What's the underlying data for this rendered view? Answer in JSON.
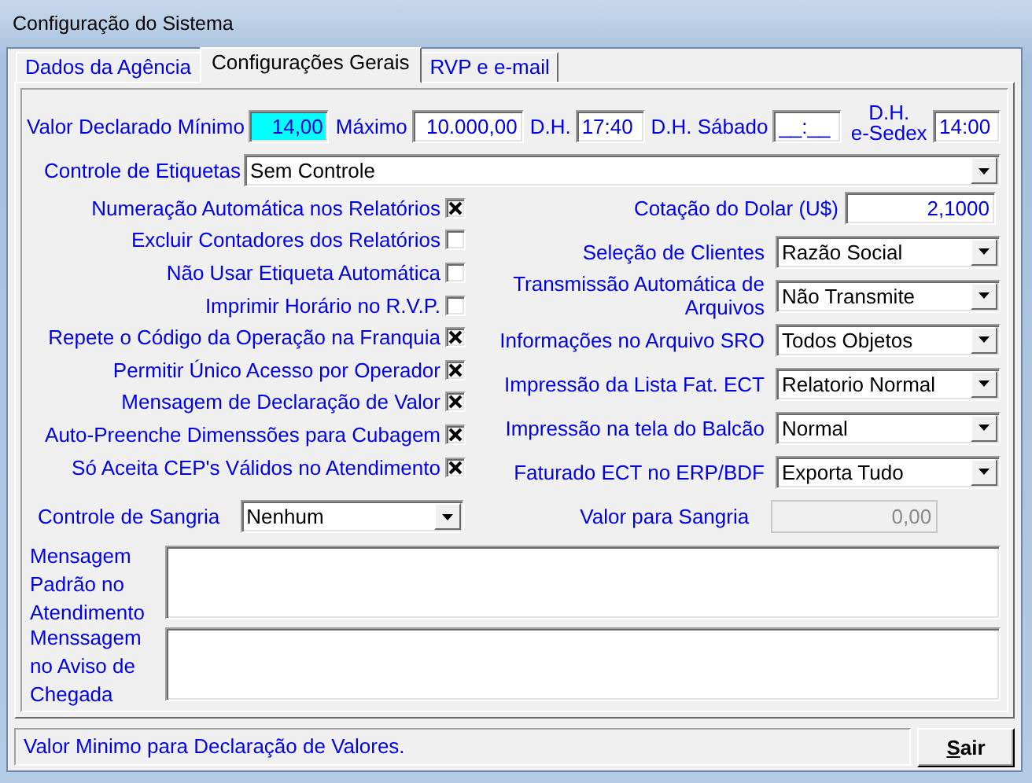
{
  "window": {
    "title": "Configuração do Sistema"
  },
  "tabs": [
    {
      "label": "Dados da Agência",
      "selected": false
    },
    {
      "label": "Configurações Gerais",
      "selected": true
    },
    {
      "label": "RVP e e-mail",
      "selected": false
    }
  ],
  "top_fields": [
    {
      "label": "Valor Declarado Mínimo",
      "value": "14,00",
      "focused": true
    },
    {
      "label": "Máximo",
      "value": "10.000,00",
      "focused": false
    },
    {
      "label": "D.H.",
      "value": "17:40",
      "focused": false
    },
    {
      "label": "D.H. Sábado",
      "value": "__:__",
      "focused": false
    },
    {
      "label": "D.H. e-Sedex",
      "value": "14:00",
      "focused": false
    }
  ],
  "label_control": {
    "label": "Controle de Etiquetas",
    "value": "Sem Controle"
  },
  "options": [
    {
      "label": "Numeração Automática nos Relatórios",
      "checked": true
    },
    {
      "label": "Excluir Contadores dos Relatórios",
      "checked": false
    },
    {
      "label": "Não Usar Etiqueta Automática",
      "checked": false
    },
    {
      "label": "Imprimir Horário no R.V.P.",
      "checked": false
    },
    {
      "label": "Repete o Código da Operação na Franquia",
      "checked": true
    },
    {
      "label": "Permitir Único Acesso por Operador",
      "checked": true
    },
    {
      "label": "Mensagem de Declaração de Valor",
      "checked": true
    },
    {
      "label": "Auto-Preenche Dimenssões para Cubagem",
      "checked": true
    },
    {
      "label": "Só Aceita CEP's Válidos no Atendimento",
      "checked": true
    }
  ],
  "settings": [
    {
      "kind": "text",
      "label": "Cotação do Dolar (U$)",
      "value": "2,1000"
    },
    {
      "kind": "combo",
      "label": "Seleção de Clientes",
      "value": "Razão Social"
    },
    {
      "kind": "combo",
      "label": "Transmissão Automática de Arquivos",
      "value": "Não Transmite"
    },
    {
      "kind": "combo",
      "label": "Informações no Arquivo SRO",
      "value": "Todos Objetos"
    },
    {
      "kind": "combo",
      "label": "Impressão da Lista Fat. ECT",
      "value": "Relatorio Normal"
    },
    {
      "kind": "combo",
      "label": "Impressão na tela do Balcão",
      "value": "Normal"
    },
    {
      "kind": "combo",
      "label": "Faturado ECT no ERP/BDF",
      "value": "Exporta Tudo"
    }
  ],
  "sangria": {
    "control": {
      "label": "Controle de Sangria",
      "value": "Nenhum"
    },
    "amount": {
      "label": "Valor para Sangria",
      "value": "0,00",
      "disabled": true
    }
  },
  "messages": [
    {
      "label": "Mensagem Padrão no Atendimento"
    },
    {
      "label": "Menssagem no Aviso de Chegada"
    }
  ],
  "status_bar": {
    "text": "Valor Minimo para Declaração de Valores.",
    "button": "Sair"
  }
}
